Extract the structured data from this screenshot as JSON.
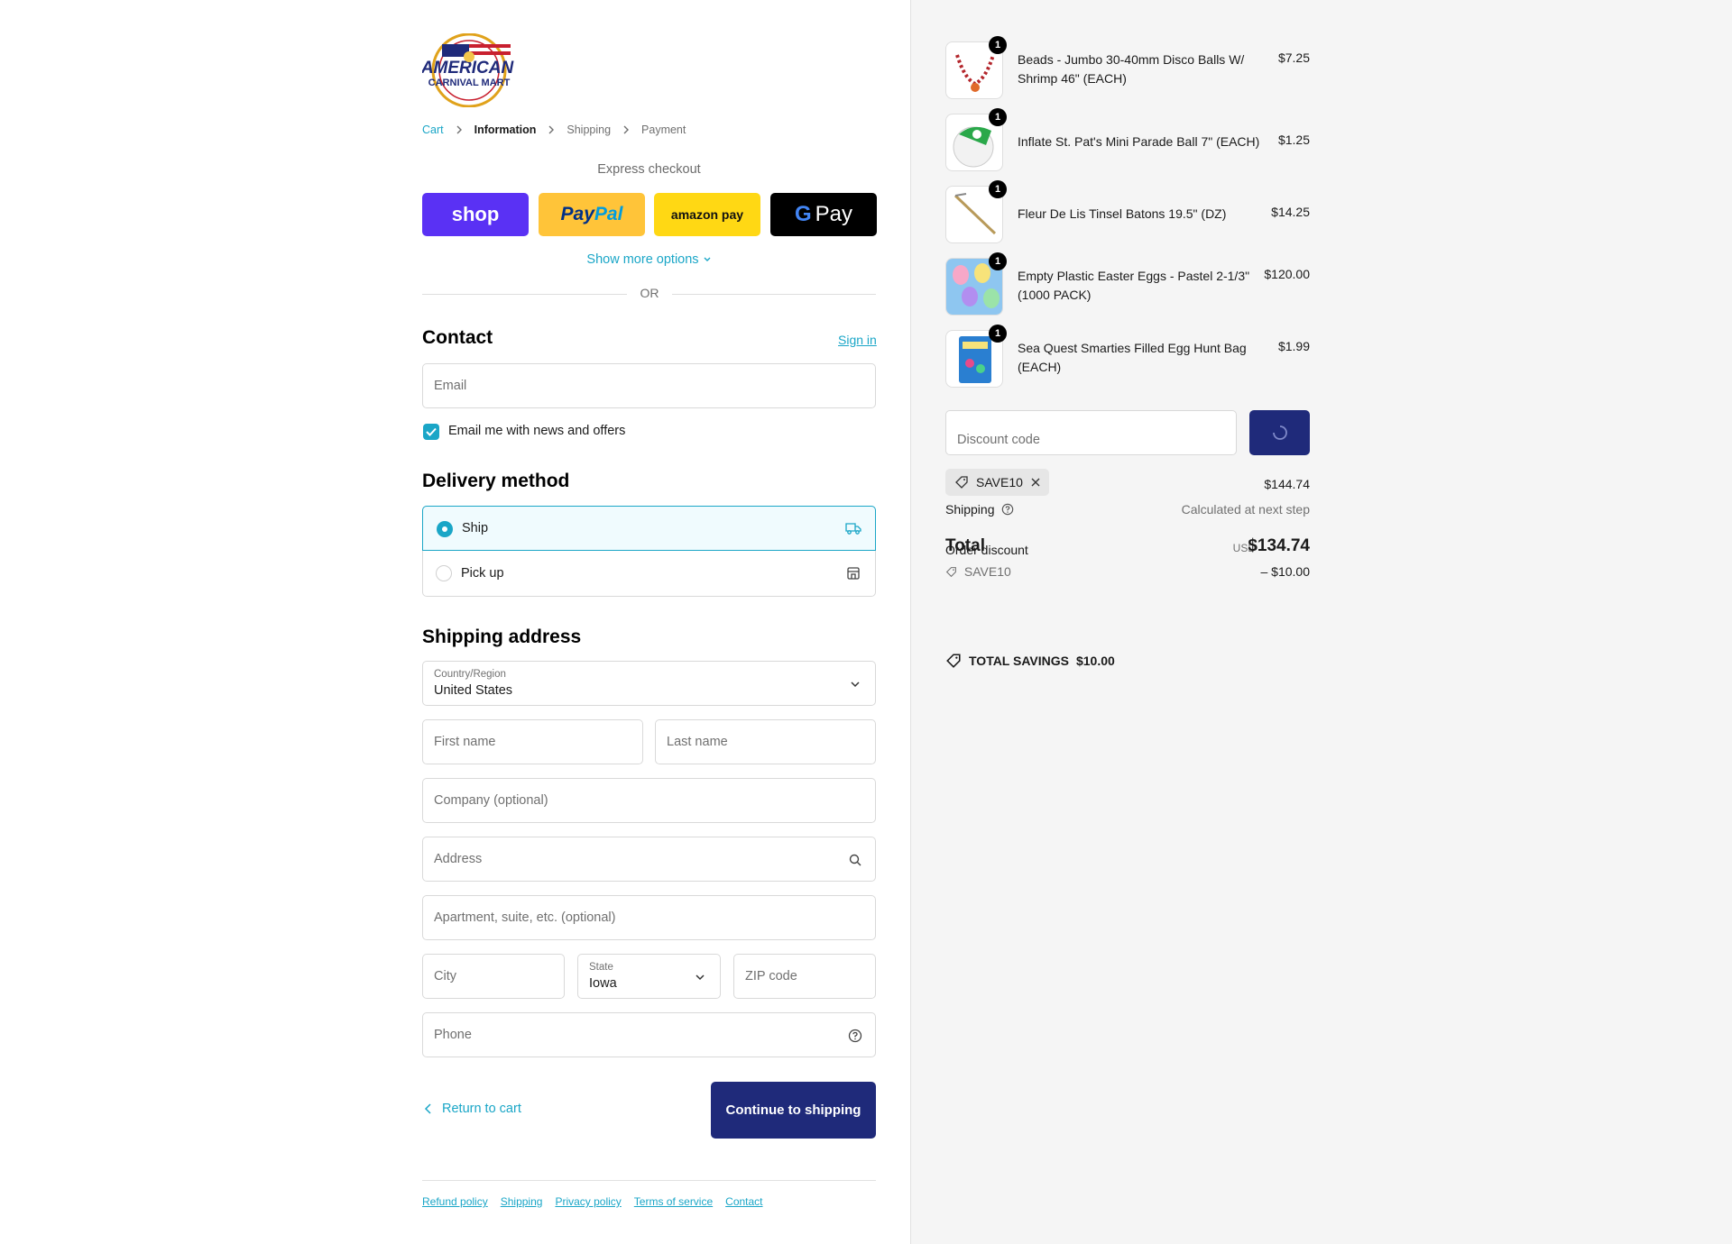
{
  "logo": {
    "alt": "American Carnival Mart"
  },
  "breadcrumb": {
    "cart": "Cart",
    "information": "Information",
    "shipping": "Shipping",
    "payment": "Payment"
  },
  "express": {
    "title": "Express checkout",
    "shop_label": "shop",
    "paypal_1": "Pay",
    "paypal_2": "Pal",
    "amazon_label": "amazon pay",
    "gpay_label": "Pay",
    "show_more": "Show more options",
    "or": "OR"
  },
  "contact": {
    "heading": "Contact",
    "sign_in": "Sign in",
    "email_placeholder": "Email",
    "newsletter_label": "Email me with news and offers",
    "newsletter_checked": true
  },
  "delivery": {
    "heading": "Delivery method",
    "options": [
      {
        "label": "Ship",
        "selected": true
      },
      {
        "label": "Pick up",
        "selected": false
      }
    ]
  },
  "shipping_address": {
    "heading": "Shipping address",
    "country_label": "Country/Region",
    "country_value": "United States",
    "first_name": "First name",
    "last_name": "Last name",
    "company": "Company (optional)",
    "address": "Address",
    "apartment": "Apartment, suite, etc. (optional)",
    "city": "City",
    "state_label": "State",
    "state_value": "Iowa",
    "zip": "ZIP code",
    "phone": "Phone"
  },
  "actions": {
    "return": "Return to cart",
    "continue": "Continue to shipping"
  },
  "footer": [
    "Refund policy",
    "Shipping",
    "Privacy policy",
    "Terms of service",
    "Contact"
  ],
  "order": {
    "items": [
      {
        "name": "Beads - Jumbo 30-40mm Disco Balls W/ Shrimp 46\" (EACH)",
        "price": "$7.25",
        "qty": "1"
      },
      {
        "name": "Inflate St. Pat's Mini Parade Ball 7\" (EACH)",
        "price": "$1.25",
        "qty": "1"
      },
      {
        "name": "Fleur De Lis Tinsel Batons 19.5\" (DZ)",
        "price": "$14.25",
        "qty": "1"
      },
      {
        "name": "Empty Plastic Easter Eggs - Pastel 2-1/3\" (1000 PACK)",
        "price": "$120.00",
        "qty": "1"
      },
      {
        "name": "Sea Quest Smarties Filled Egg Hunt Bag (EACH)",
        "price": "$1.99",
        "qty": "1"
      }
    ],
    "discount_placeholder": "Discount code",
    "applied_code": "SAVE10",
    "subtotal": "$144.74",
    "shipping_label": "Shipping",
    "shipping_value": "Calculated at next step",
    "order_discount_label": "Order discount",
    "discount_code": "SAVE10",
    "discount_value": "– $10.00",
    "total_label": "Total",
    "currency": "USD",
    "total": "$134.74",
    "savings_label": "TOTAL SAVINGS",
    "savings_value": "$10.00"
  },
  "colors": {
    "accent": "#1aa6c7",
    "button": "#1f2a7a",
    "shop": "#5a31f4",
    "paypal": "#ffc439",
    "amazon": "#ffd814"
  }
}
